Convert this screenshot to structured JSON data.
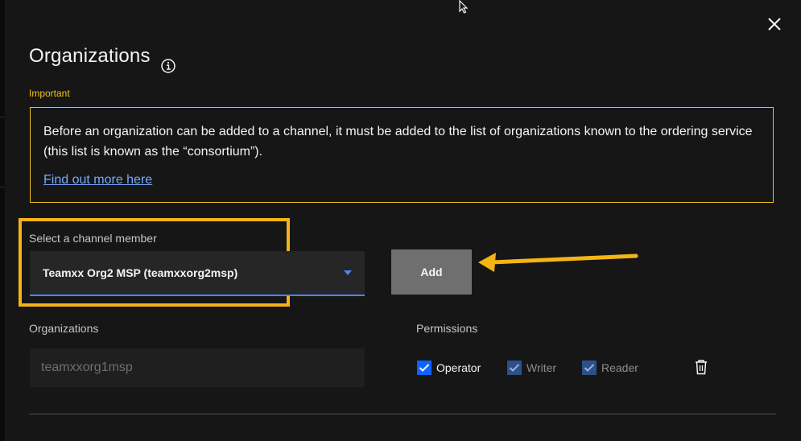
{
  "dialog": {
    "title": "Organizations",
    "important_label": "Important",
    "notice_text": "Before an organization can be added to a channel, it must be added to the list of organizations known to the ordering service (this list is known as the “consortium”).",
    "notice_link": "Find out more here"
  },
  "member_select": {
    "label": "Select a channel member",
    "value": "Teamxx Org2 MSP (teamxxorg2msp)"
  },
  "add_button": {
    "label": "Add"
  },
  "organizations": {
    "label": "Organizations",
    "items": [
      {
        "name": "teamxxorg1msp",
        "permissions": [
          {
            "label": "Operator",
            "checked": true,
            "enabled": true
          },
          {
            "label": "Writer",
            "checked": true,
            "enabled": false
          },
          {
            "label": "Reader",
            "checked": true,
            "enabled": false
          }
        ]
      }
    ]
  },
  "permissions_label": "Permissions",
  "colors": {
    "background": "#161616",
    "warning": "#f1c21b",
    "annotation": "#f6b414",
    "link": "#78a9ff",
    "primary": "#0f62fe",
    "field": "#262626"
  },
  "icons": [
    "close-icon",
    "info-icon",
    "chevron-down-icon",
    "checkmark-icon",
    "trash-icon",
    "mouse-cursor-icon",
    "annotation-arrow-icon"
  ]
}
